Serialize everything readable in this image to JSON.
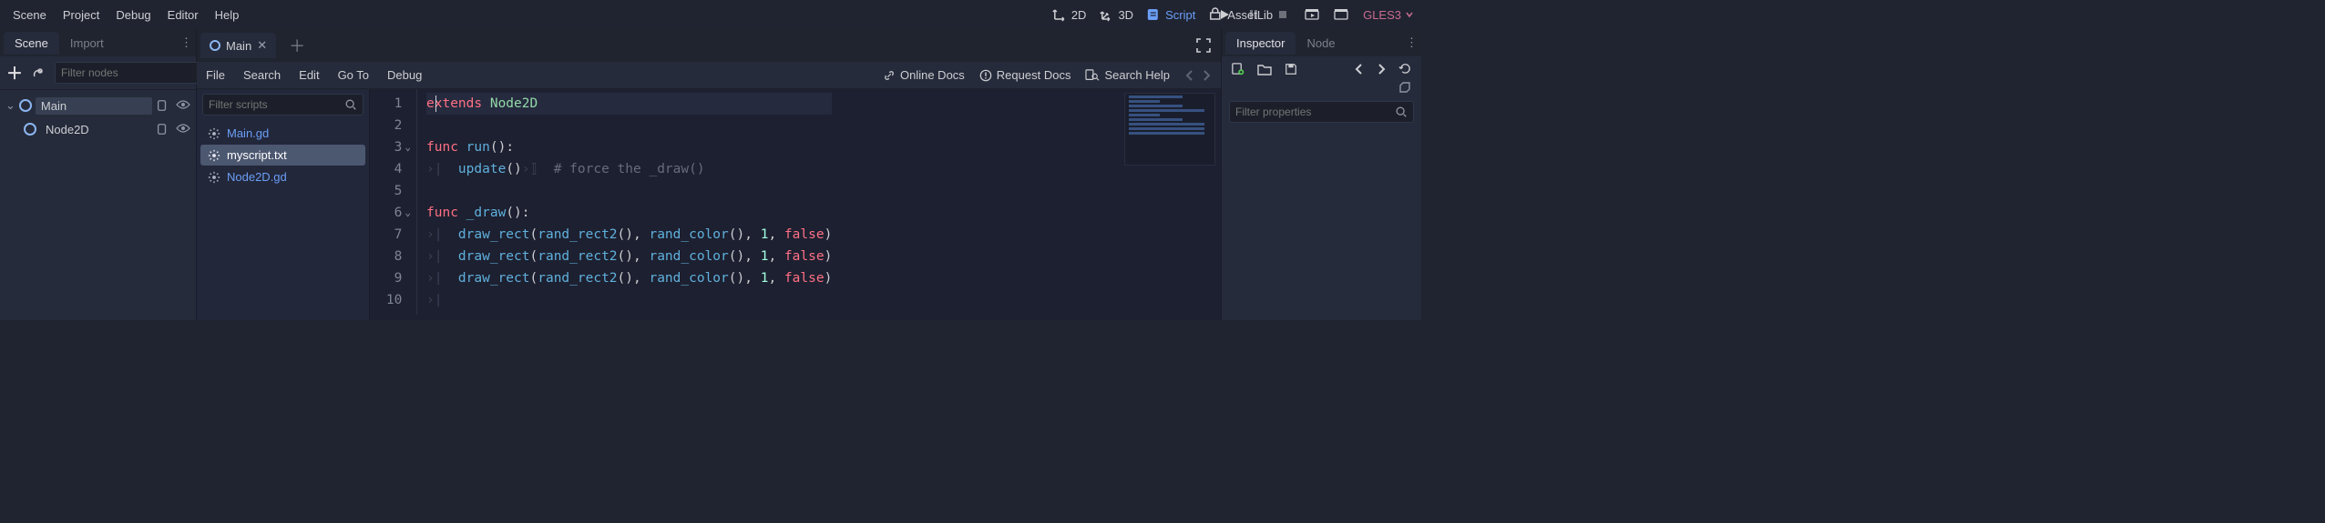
{
  "menubar": [
    "Scene",
    "Project",
    "Debug",
    "Editor",
    "Help"
  ],
  "viewSwitcher": {
    "v2d": "2D",
    "v3d": "3D",
    "script": "Script",
    "assetlib": "AssetLib"
  },
  "renderer": "GLES3",
  "leftDock": {
    "tabs": {
      "scene": "Scene",
      "import": "Import"
    },
    "filter_placeholder": "Filter nodes",
    "tree": {
      "root": "Main",
      "child": "Node2D"
    }
  },
  "scriptPanel": {
    "openTab": "Main",
    "menu": [
      "File",
      "Search",
      "Edit",
      "Go To",
      "Debug"
    ],
    "help": {
      "online": "Online Docs",
      "request": "Request Docs",
      "search": "Search Help"
    },
    "filter_placeholder": "Filter scripts",
    "scripts": [
      "Main.gd",
      "myscript.txt",
      "Node2D.gd"
    ],
    "selectedScript": 1
  },
  "code": {
    "lines": [
      {
        "n": 1,
        "fold": "",
        "tokens": [
          [
            "kw",
            "extends"
          ],
          [
            "",
            ""
          ],
          [
            "type",
            " Node2D"
          ]
        ]
      },
      {
        "n": 2,
        "fold": "",
        "tokens": []
      },
      {
        "n": 3,
        "fold": "v",
        "tokens": [
          [
            "kw",
            "func"
          ],
          [
            "",
            " "
          ],
          [
            "fn",
            "run"
          ],
          [
            "paren",
            "():"
          ]
        ]
      },
      {
        "n": 4,
        "fold": "",
        "tokens": [
          [
            "guide",
            "›|  "
          ],
          [
            "builtin",
            "update"
          ],
          [
            "paren",
            "()"
          ],
          [
            "guide",
            "›⟧  "
          ],
          [
            "comment",
            "# force the _draw()"
          ]
        ]
      },
      {
        "n": 5,
        "fold": "",
        "tokens": []
      },
      {
        "n": 6,
        "fold": "v",
        "tokens": [
          [
            "kw",
            "func"
          ],
          [
            "",
            " "
          ],
          [
            "fn",
            "_draw"
          ],
          [
            "paren",
            "():"
          ]
        ]
      },
      {
        "n": 7,
        "fold": "",
        "tokens": [
          [
            "guide",
            "›|  "
          ],
          [
            "builtin",
            "draw_rect"
          ],
          [
            "paren",
            "("
          ],
          [
            "builtin",
            "rand_rect2"
          ],
          [
            "paren",
            "(), "
          ],
          [
            "builtin",
            "rand_color"
          ],
          [
            "paren",
            "(), "
          ],
          [
            "num",
            "1"
          ],
          [
            "paren",
            ", "
          ],
          [
            "bool",
            "false"
          ],
          [
            "paren",
            ")"
          ]
        ]
      },
      {
        "n": 8,
        "fold": "",
        "tokens": [
          [
            "guide",
            "›|  "
          ],
          [
            "builtin",
            "draw_rect"
          ],
          [
            "paren",
            "("
          ],
          [
            "builtin",
            "rand_rect2"
          ],
          [
            "paren",
            "(), "
          ],
          [
            "builtin",
            "rand_color"
          ],
          [
            "paren",
            "(), "
          ],
          [
            "num",
            "1"
          ],
          [
            "paren",
            ", "
          ],
          [
            "bool",
            "false"
          ],
          [
            "paren",
            ")"
          ]
        ]
      },
      {
        "n": 9,
        "fold": "",
        "tokens": [
          [
            "guide",
            "›|  "
          ],
          [
            "builtin",
            "draw_rect"
          ],
          [
            "paren",
            "("
          ],
          [
            "builtin",
            "rand_rect2"
          ],
          [
            "paren",
            "(), "
          ],
          [
            "builtin",
            "rand_color"
          ],
          [
            "paren",
            "(), "
          ],
          [
            "num",
            "1"
          ],
          [
            "paren",
            ", "
          ],
          [
            "bool",
            "false"
          ],
          [
            "paren",
            ")"
          ]
        ]
      },
      {
        "n": 10,
        "fold": "",
        "tokens": [
          [
            "guide",
            "›|"
          ]
        ]
      }
    ]
  },
  "rightDock": {
    "tabs": {
      "inspector": "Inspector",
      "node": "Node"
    },
    "filter_placeholder": "Filter properties"
  }
}
